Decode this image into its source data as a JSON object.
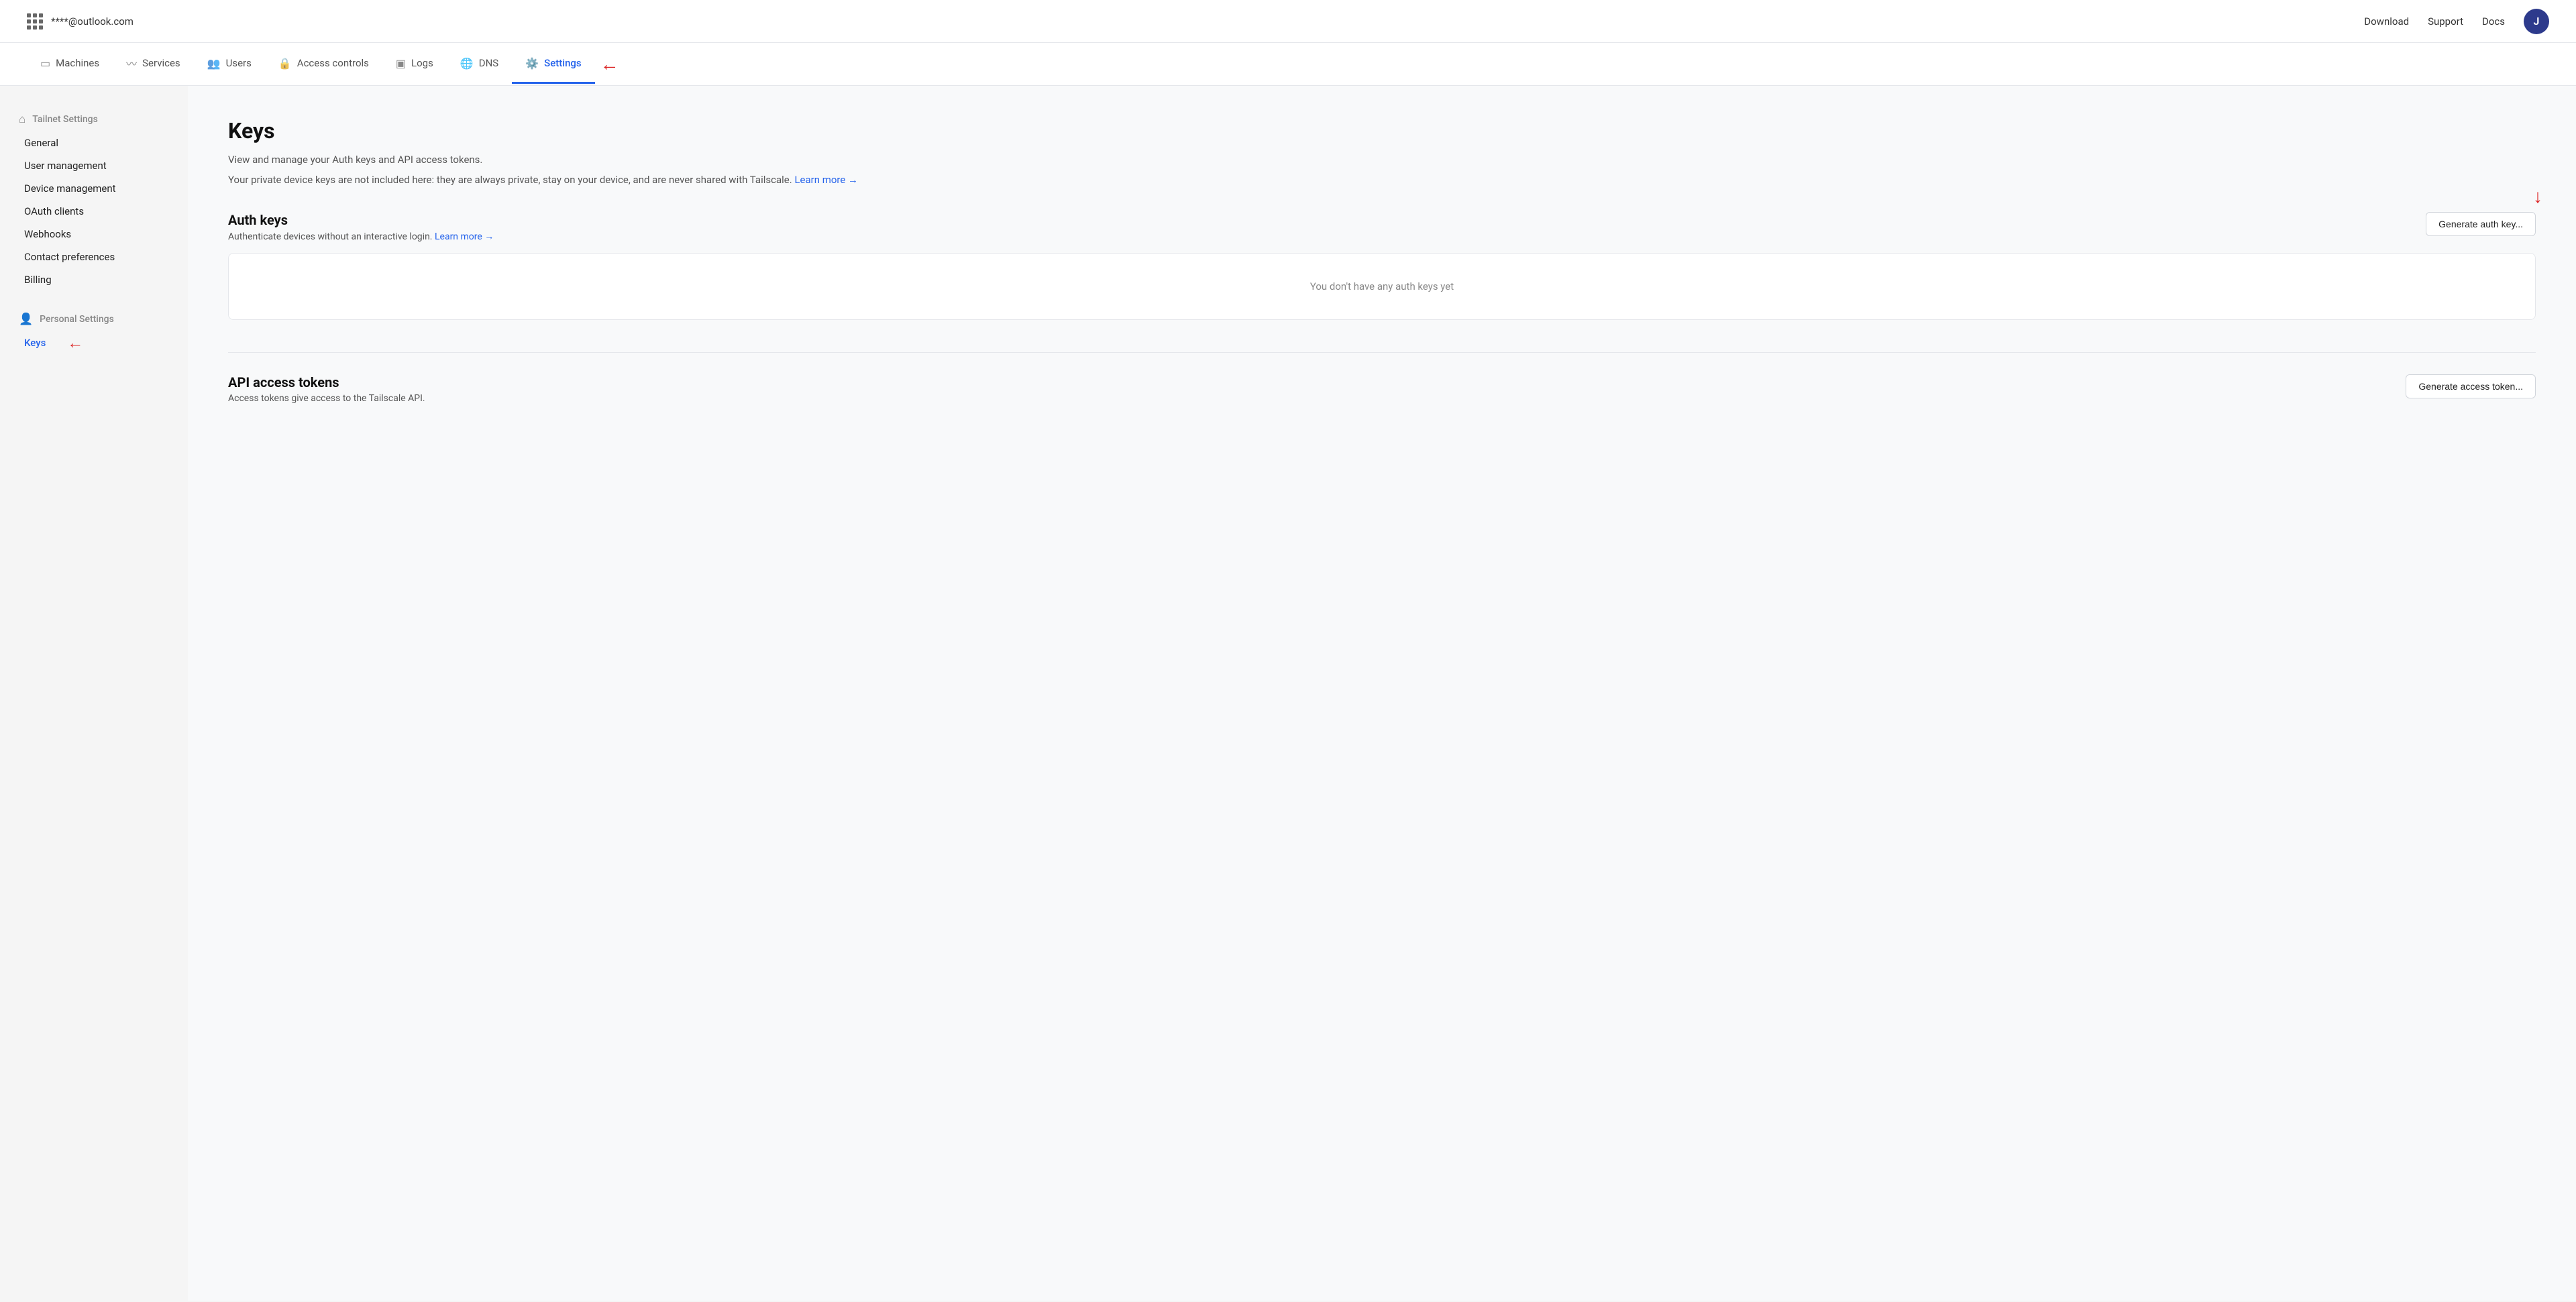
{
  "topbar": {
    "grid_icon_label": "menu",
    "user_email": "****@outlook.com",
    "links": [
      "Download",
      "Support",
      "Docs"
    ],
    "avatar_initial": "J"
  },
  "navbar": {
    "items": [
      {
        "id": "machines",
        "label": "Machines",
        "icon": "☰",
        "active": false
      },
      {
        "id": "services",
        "label": "Services",
        "icon": "📶",
        "active": false
      },
      {
        "id": "users",
        "label": "Users",
        "icon": "👥",
        "active": false
      },
      {
        "id": "access-controls",
        "label": "Access controls",
        "icon": "🔒",
        "active": false
      },
      {
        "id": "logs",
        "label": "Logs",
        "icon": "▣",
        "active": false
      },
      {
        "id": "dns",
        "label": "DNS",
        "icon": "🌐",
        "active": false
      },
      {
        "id": "settings",
        "label": "Settings",
        "icon": "⚙️",
        "active": true
      }
    ]
  },
  "sidebar": {
    "tailnet_section_label": "Tailnet Settings",
    "tailnet_items": [
      {
        "id": "general",
        "label": "General",
        "active": false
      },
      {
        "id": "user-management",
        "label": "User management",
        "active": false
      },
      {
        "id": "device-management",
        "label": "Device management",
        "active": false
      },
      {
        "id": "oauth-clients",
        "label": "OAuth clients",
        "active": false
      },
      {
        "id": "webhooks",
        "label": "Webhooks",
        "active": false
      },
      {
        "id": "contact-preferences",
        "label": "Contact preferences",
        "active": false
      },
      {
        "id": "billing",
        "label": "Billing",
        "active": false
      }
    ],
    "personal_section_label": "Personal Settings",
    "personal_items": [
      {
        "id": "keys",
        "label": "Keys",
        "active": true
      }
    ]
  },
  "main": {
    "page_title": "Keys",
    "desc1": "View and manage your Auth keys and API access tokens.",
    "desc2_part1": "Your private device keys are not included here: they are always private, stay on your device, and are",
    "desc2_part2": "never shared with Tailscale.",
    "learn_more_keys": "Learn more →",
    "auth_keys": {
      "title": "Auth keys",
      "description": "Authenticate devices without an interactive login.",
      "learn_more_label": "Learn more →",
      "button_label": "Generate auth key...",
      "empty_message": "You don't have any auth keys yet"
    },
    "api_tokens": {
      "title": "API access tokens",
      "description": "Access tokens give access to the Tailscale API.",
      "button_label": "Generate access token..."
    }
  }
}
